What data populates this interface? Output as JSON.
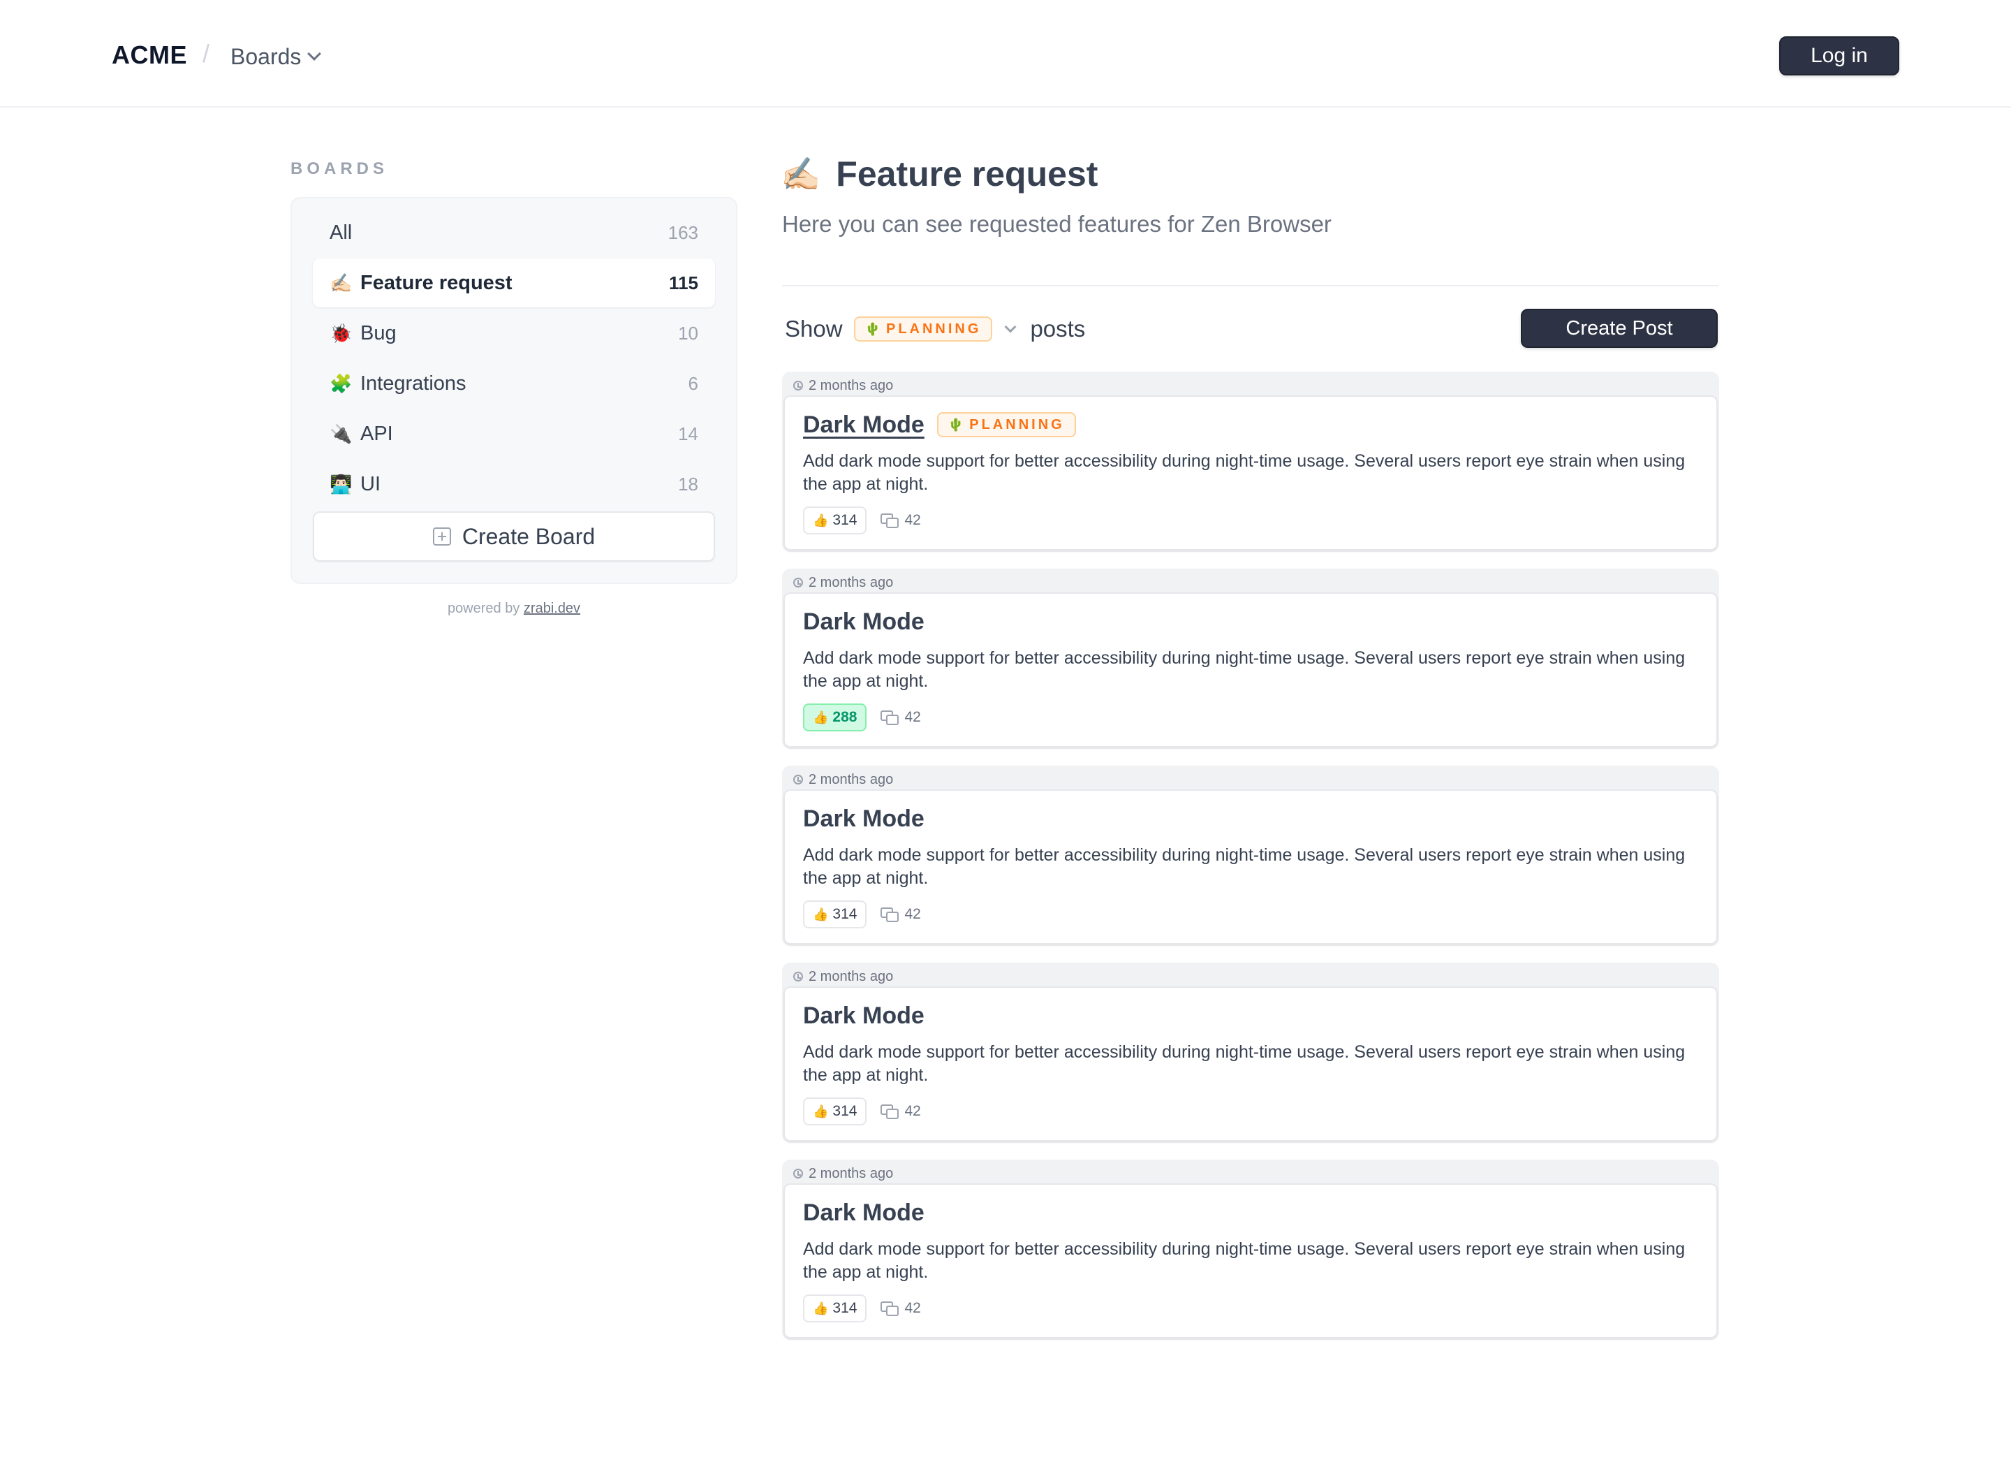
{
  "header": {
    "brand": "ACME",
    "separator": "/",
    "boards_menu_label": "Boards",
    "login_label": "Log in"
  },
  "sidebar": {
    "heading": "BOARDS",
    "items": [
      {
        "emoji": "",
        "label": "All",
        "count": "163",
        "active": false
      },
      {
        "emoji": "✍🏻",
        "label": "Feature request",
        "count": "115",
        "active": true
      },
      {
        "emoji": "🐞",
        "label": "Bug",
        "count": "10",
        "active": false
      },
      {
        "emoji": "🧩",
        "label": "Integrations",
        "count": "6",
        "active": false
      },
      {
        "emoji": "🔌",
        "label": "API",
        "count": "14",
        "active": false
      },
      {
        "emoji": "👨🏻‍💻",
        "label": "UI",
        "count": "18",
        "active": false
      }
    ],
    "create_board_label": "Create Board",
    "powered_prefix": "powered by",
    "powered_link": "zrabi.dev"
  },
  "main": {
    "emoji": "✍🏻",
    "title": "Feature request",
    "subtitle": "Here you can see requested features for Zen Browser",
    "filter": {
      "show_label": "Show",
      "status_emoji": "🌵",
      "status_label": "PLANNING",
      "posts_label": "posts"
    },
    "create_post_label": "Create Post"
  },
  "posts": [
    {
      "time": "2 months ago",
      "title": "Dark Mode",
      "status_emoji": "🌵",
      "status": "PLANNING",
      "description": "Add dark mode support for better accessibility during night-time usage. Several users report eye strain when using the app at night.",
      "votes": "314",
      "voted": false,
      "comments": "42"
    },
    {
      "time": "2 months ago",
      "title": "Dark Mode",
      "status": "",
      "description": "Add dark mode support for better accessibility during night-time usage. Several users report eye strain when using the app at night.",
      "votes": "288",
      "voted": true,
      "comments": "42"
    },
    {
      "time": "2 months ago",
      "title": "Dark Mode",
      "status": "",
      "description": "Add dark mode support for better accessibility during night-time usage. Several users report eye strain when using the app at night.",
      "votes": "314",
      "voted": false,
      "comments": "42"
    },
    {
      "time": "2 months ago",
      "title": "Dark Mode",
      "status": "",
      "description": "Add dark mode support for better accessibility during night-time usage. Several users report eye strain when using the app at night.",
      "votes": "314",
      "voted": false,
      "comments": "42"
    },
    {
      "time": "2 months ago",
      "title": "Dark Mode",
      "status": "",
      "description": "Add dark mode support for better accessibility during night-time usage. Several users report eye strain when using the app at night.",
      "votes": "314",
      "voted": false,
      "comments": "42"
    }
  ],
  "colors": {
    "primary_button": "#2d3344",
    "planning_accent": "#f97316",
    "voted_bg": "#d1fae5",
    "voted_text": "#059669"
  }
}
